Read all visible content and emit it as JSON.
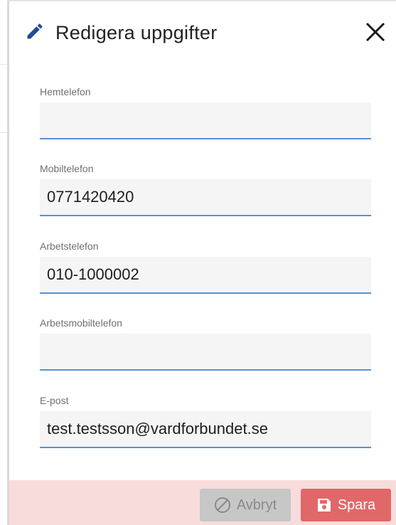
{
  "dialog": {
    "title": "Redigera uppgifter",
    "icon": "pencil-icon",
    "close_icon": "close-icon"
  },
  "fields": [
    {
      "label": "Hemtelefon",
      "value": "",
      "placeholder": ""
    },
    {
      "label": "Mobiltelefon",
      "value": "0771420420",
      "placeholder": ""
    },
    {
      "label": "Arbetstelefon",
      "value": "010-1000002",
      "placeholder": ""
    },
    {
      "label": "Arbetsmobiltelefon",
      "value": "",
      "placeholder": ""
    },
    {
      "label": "E-post",
      "value": "test.testsson@vardforbundet.se",
      "placeholder": ""
    }
  ],
  "footer": {
    "cancel_label": "Avbryt",
    "cancel_icon": "ban-icon",
    "save_label": "Spara",
    "save_icon": "floppy-disk-icon"
  },
  "colors": {
    "accent_underline": "#5b8fd6",
    "footer_bg": "#f8dcdc",
    "save_bg": "#e06868",
    "cancel_bg": "#c7c7c7",
    "pencil": "#1f4e96"
  }
}
